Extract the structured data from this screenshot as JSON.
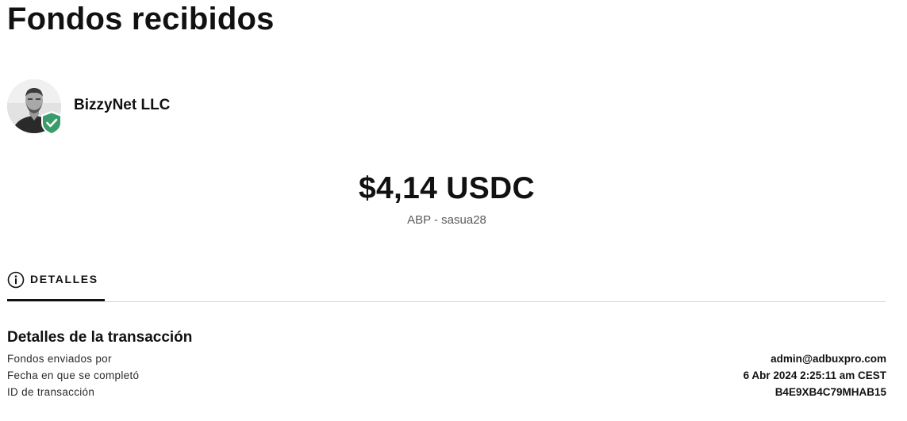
{
  "page": {
    "title": "Fondos recibidos"
  },
  "sender": {
    "name": "BizzyNet LLC",
    "avatar_icon": "user-photo",
    "badge_icon": "verified-shield-icon",
    "badge_color": "#3a9b6b"
  },
  "amount": {
    "value": "$4,14 USDC",
    "subtitle": "ABP - sasua28"
  },
  "tabs": [
    {
      "label": "DETALLES",
      "icon": "info-icon",
      "active": true
    }
  ],
  "details": {
    "title": "Detalles de la transacción",
    "rows": [
      {
        "label": "Fondos enviados por",
        "value": "admin@adbuxpro.com"
      },
      {
        "label": "Fecha en que se completó",
        "value": "6 Abr 2024 2:25:11 am CEST"
      },
      {
        "label": "ID de transacción",
        "value": "B4E9XB4C79MHAB15"
      }
    ]
  }
}
